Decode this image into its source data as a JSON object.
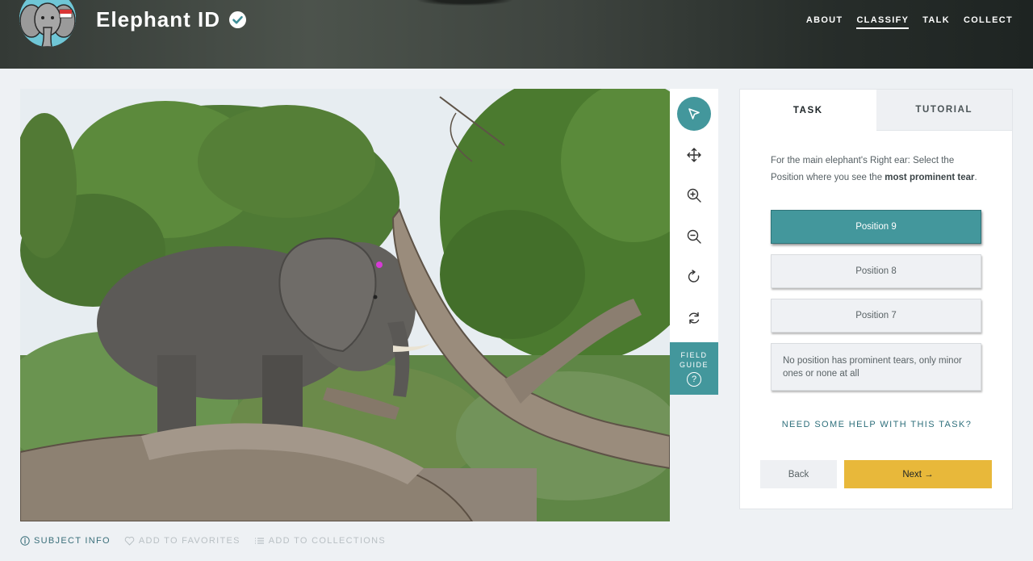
{
  "project": {
    "title": "Elephant ID"
  },
  "nav": {
    "items": [
      {
        "label": "ABOUT",
        "active": false
      },
      {
        "label": "CLASSIFY",
        "active": true
      },
      {
        "label": "TALK",
        "active": false
      },
      {
        "label": "COLLECT",
        "active": false
      }
    ]
  },
  "toolbar": {
    "tools": [
      {
        "name": "annotate-tool",
        "icon": "pointer-arrow-icon",
        "active": true
      },
      {
        "name": "move-tool",
        "icon": "move-arrows-icon",
        "active": false
      },
      {
        "name": "zoom-in-tool",
        "icon": "zoom-in-icon",
        "active": false
      },
      {
        "name": "zoom-out-tool",
        "icon": "zoom-out-icon",
        "active": false
      },
      {
        "name": "rotate-tool",
        "icon": "rotate-icon",
        "active": false
      },
      {
        "name": "reset-tool",
        "icon": "reset-icon",
        "active": false
      }
    ],
    "field_guide_line1": "FIELD",
    "field_guide_line2": "GUIDE",
    "field_guide_icon": "?"
  },
  "task_panel": {
    "tab_task": "TASK",
    "tab_tutorial": "TUTORIAL",
    "question_part1": "For the main elephant's Right ear: Select the Position where you see the ",
    "question_bold": "most prominent tear",
    "question_part2": ".",
    "answers": [
      {
        "label": "Position 9",
        "selected": true
      },
      {
        "label": "Position 8",
        "selected": false
      },
      {
        "label": "Position 7",
        "selected": false
      },
      {
        "label": "No position has prominent tears, only minor ones or none at all",
        "selected": false
      }
    ],
    "help_link": "NEED SOME HELP WITH THIS TASK?",
    "back_label": "Back",
    "next_label": "Next →"
  },
  "meta": {
    "subject_info": "SUBJECT INFO",
    "add_to_favorites": "ADD TO FAVORITES",
    "add_to_collections": "ADD TO COLLECTIONS"
  },
  "colors": {
    "teal": "#43979c",
    "next_button": "#e8b83a",
    "link": "#2e6f7b",
    "annotation_marker": "#d63ad6"
  }
}
